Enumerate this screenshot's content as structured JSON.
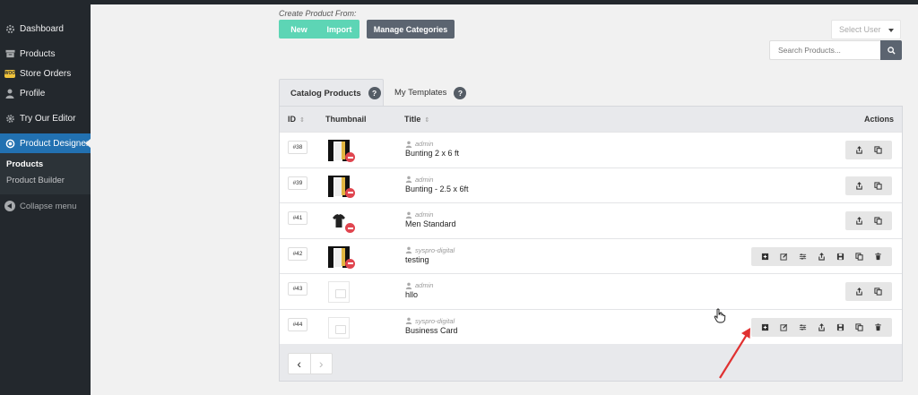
{
  "sidebar": {
    "items": [
      {
        "label": "Dashboard",
        "icon": "gauge-icon"
      },
      {
        "label": "Products",
        "icon": "archive-icon"
      },
      {
        "label": "Store Orders",
        "icon": "woocommerce-icon"
      },
      {
        "label": "Profile",
        "icon": "user-icon"
      },
      {
        "label": "Try Our Editor",
        "icon": "gear-icon"
      },
      {
        "label": "Product Designer",
        "icon": "circle-icon"
      }
    ],
    "woo_badge": "WOO",
    "submenu": [
      "Products",
      "Product Builder"
    ],
    "collapse": "Collapse menu"
  },
  "toolbar": {
    "create_label": "Create Product From:",
    "new_label": "New",
    "import_label": "Import",
    "manage_label": "Manage Categories",
    "select_user": "Select User",
    "search_placeholder": "Search Products..."
  },
  "tabs": {
    "catalog": "Catalog Products",
    "templates": "My Templates",
    "help": "?"
  },
  "table": {
    "headers": {
      "id": "ID",
      "thumbnail": "Thumbnail",
      "title": "Title",
      "actions": "Actions"
    },
    "sort_glyph": "⇕",
    "rows": [
      {
        "id": "#38",
        "author": "admin",
        "title": "Bunting 2 x 6 ft"
      },
      {
        "id": "#39",
        "author": "admin",
        "title": "Bunting - 2.5 x 6ft"
      },
      {
        "id": "#41",
        "author": "admin",
        "title": "Men Standard"
      },
      {
        "id": "#42",
        "author": "syspro-digital",
        "title": "testing"
      },
      {
        "id": "#43",
        "author": "admin",
        "title": "hllo"
      },
      {
        "id": "#44",
        "author": "syspro-digital",
        "title": "Business Card"
      }
    ]
  },
  "pager": {
    "prev": "‹",
    "next": "›"
  },
  "colors": {
    "sidebar_bg": "#23282d",
    "accent_blue": "#2271b1",
    "new_green": "#5dd5b5",
    "button_grey": "#5b6470",
    "delete_red": "#e0454f",
    "arrow_red": "#e03131"
  }
}
